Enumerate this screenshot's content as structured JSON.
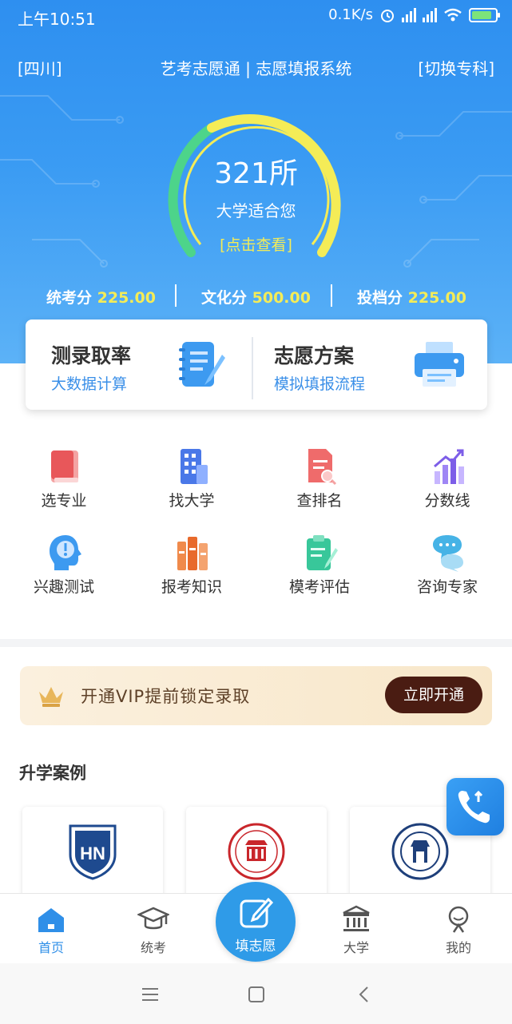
{
  "status_bar": {
    "time": "上午10:51",
    "network_speed": "0.1K/s",
    "network_type": "HD"
  },
  "header": {
    "region": "[四川]",
    "title": "艺考志愿通 | 志愿填报系统",
    "switch": "[切换专科]"
  },
  "gauge": {
    "count": "321所",
    "subtitle": "大学适合您",
    "link": "[点击查看]"
  },
  "scores": [
    {
      "label": "统考分",
      "value": "225.00"
    },
    {
      "label": "文化分",
      "value": "500.00"
    },
    {
      "label": "投档分",
      "value": "225.00"
    }
  ],
  "feature_cards": [
    {
      "title": "测录取率",
      "subtitle": "大数据计算",
      "icon": "notebook-pen-icon"
    },
    {
      "title": "志愿方案",
      "subtitle": "模拟填报流程",
      "icon": "printer-icon"
    }
  ],
  "grid": [
    {
      "label": "选专业",
      "icon": "book-icon"
    },
    {
      "label": "找大学",
      "icon": "building-icon"
    },
    {
      "label": "查排名",
      "icon": "document-search-icon"
    },
    {
      "label": "分数线",
      "icon": "bar-chart-up-icon"
    },
    {
      "label": "兴趣测试",
      "icon": "head-exclamation-icon"
    },
    {
      "label": "报考知识",
      "icon": "books-icon"
    },
    {
      "label": "模考评估",
      "icon": "clipboard-pen-icon"
    },
    {
      "label": "咨询专家",
      "icon": "chat-bubbles-icon"
    }
  ],
  "vip_banner": {
    "text": "开通VIP提前锁定录取",
    "button": "立即开通",
    "icon": "crown-icon"
  },
  "cases": {
    "title": "升学案例",
    "items": [
      {
        "logo": "HN"
      },
      {
        "logo": "四川电影电视学院"
      },
      {
        "logo": "西南大学"
      }
    ]
  },
  "tabbar": {
    "home": "首页",
    "exam": "统考",
    "fill": "填志愿",
    "university": "大学",
    "mine": "我的"
  },
  "colors": {
    "primary": "#2e8ff0",
    "accent_yellow": "#f4ec57",
    "accent_green": "#4dd48a",
    "vip_brown": "#4a1c12"
  }
}
